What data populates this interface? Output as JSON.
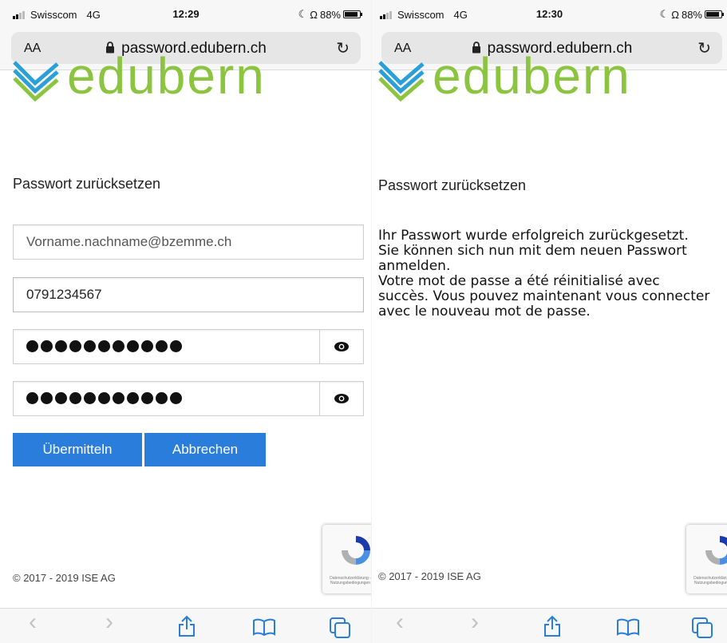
{
  "screens": [
    {
      "status": {
        "carrier": "Swisscom",
        "network": "4G",
        "time": "12:29",
        "battery": "88%"
      },
      "browser": {
        "text_size": "AA",
        "domain": "password.edubern.ch"
      },
      "logo_text": "edubern",
      "heading": "Passwort zurücksetzen",
      "form": {
        "email_placeholder": "Vorname.nachname@bzemme.ch",
        "phone_value": "0791234567",
        "password_dots": 11,
        "confirm_dots": 11
      },
      "buttons": {
        "submit": "Übermitteln",
        "cancel": "Abbrechen"
      },
      "footer": "© 2017 - 2019 ISE AG",
      "recaptcha_text": "Datenschutzerklärung - Nutzungsbedingungen"
    },
    {
      "status": {
        "carrier": "Swisscom",
        "network": "4G",
        "time": "12:30",
        "battery": "88%"
      },
      "browser": {
        "text_size": "AA",
        "domain": "password.edubern.ch"
      },
      "logo_text": "edubern",
      "heading": "Passwort zurücksetzen",
      "message": [
        "Ihr Passwort wurde erfolgreich zurückgesetzt. Sie können sich nun mit dem neuen Passwort anmelden.",
        "Votre mot de passe a été réinitialisé avec succès. Vous pouvez maintenant vous connecter avec le nouveau mot de passe."
      ],
      "footer": "© 2017 - 2019 ISE AG",
      "recaptcha_text": "Datenschutzerklärung - Nutzungsbedingungen"
    }
  ],
  "colors": {
    "accent": "#2a7ddb",
    "logo_green": "#8bc43f",
    "logo_blue": "#2a9fd8"
  },
  "icons": [
    "lock-icon",
    "reload-icon",
    "eye-icon",
    "back-icon",
    "forward-icon",
    "share-icon",
    "bookmarks-icon",
    "tabs-icon",
    "recaptcha-icon"
  ]
}
